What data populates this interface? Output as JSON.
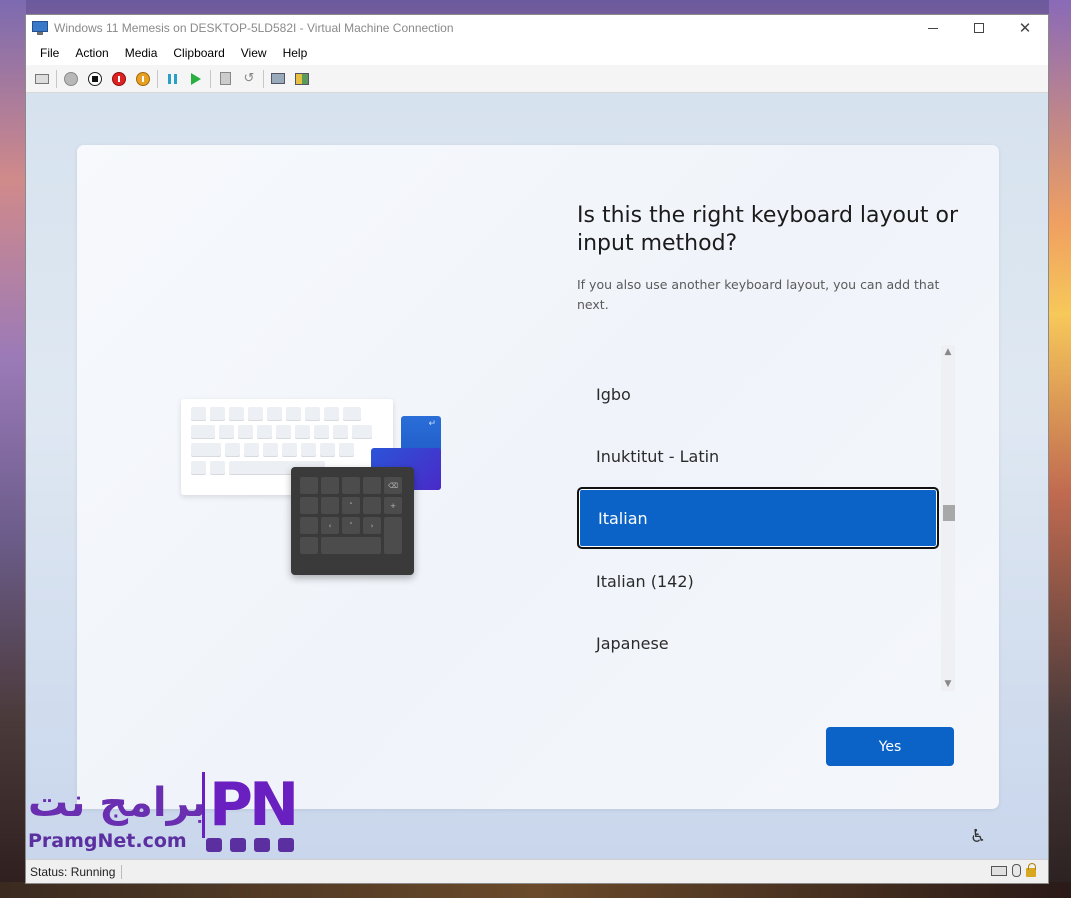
{
  "window": {
    "title": "Windows 11 Memesis on DESKTOP-5LD582I - Virtual Machine Connection"
  },
  "menu": [
    "File",
    "Action",
    "Media",
    "Clipboard",
    "View",
    "Help"
  ],
  "toolbar_icons": [
    "ctrl-alt-del-icon",
    "start-icon",
    "turn-off-icon",
    "shut-down-icon",
    "save-icon",
    "pause-icon",
    "resume-icon",
    "checkpoint-icon",
    "revert-icon",
    "enhanced-session-icon",
    "share-icon"
  ],
  "oobe": {
    "heading": "Is this the right keyboard layout or input method?",
    "subtext": "If you also use another keyboard layout, you can add that next.",
    "layouts": [
      {
        "label": "Igbo",
        "selected": false
      },
      {
        "label": "Inuktitut - Latin",
        "selected": false
      },
      {
        "label": "Italian",
        "selected": true
      },
      {
        "label": "Italian (142)",
        "selected": false
      },
      {
        "label": "Japanese",
        "selected": false
      }
    ],
    "yes_label": "Yes",
    "accent_color": "#0b63c8"
  },
  "illustration": {
    "return_glyph": "↵",
    "backspace_glyph": "⌫",
    "up_glyph": "˄",
    "plus_glyph": "+",
    "left_glyph": "‹",
    "down_glyph": "˅",
    "right_glyph": "›"
  },
  "status": {
    "text": "Status: Running"
  },
  "watermark": {
    "arabic": "برامج نت",
    "latin": "PramgNet.com",
    "logo": "PN"
  }
}
